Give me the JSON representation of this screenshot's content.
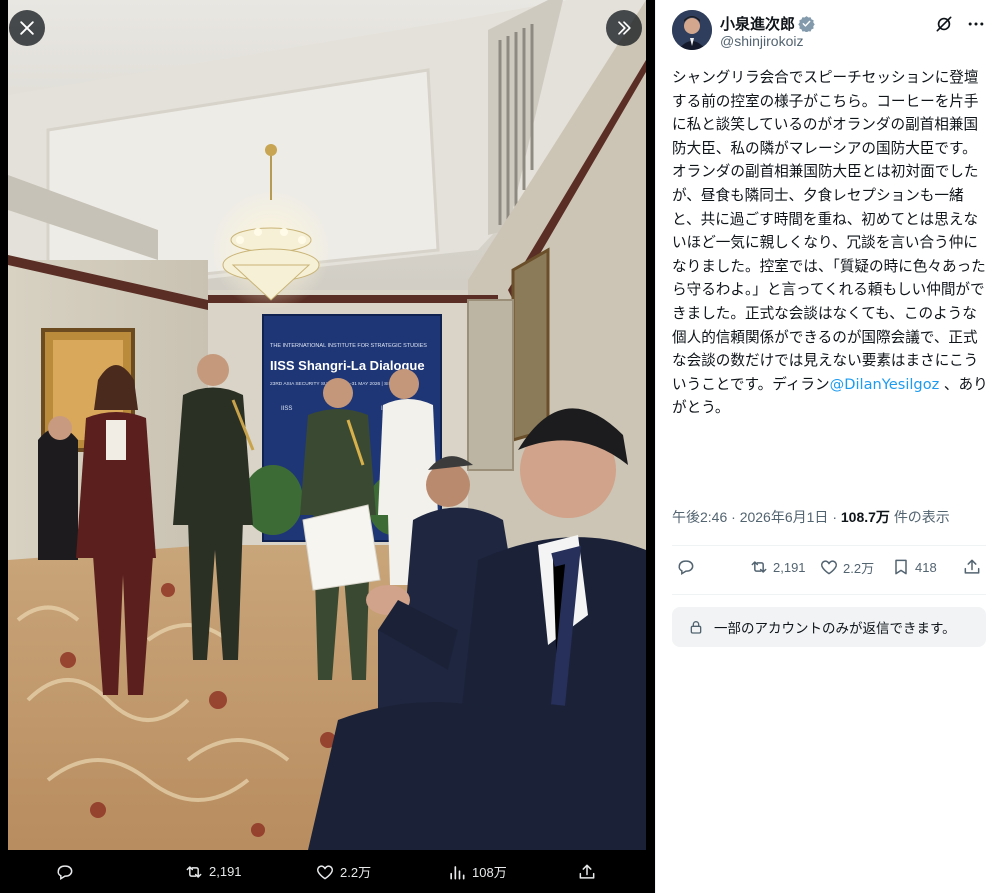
{
  "viewer": {
    "close_icon": "close-icon",
    "expand_icon": "chevrons-right-icon",
    "photo": {
      "banner_small": "THE INTERNATIONAL INSTITUTE FOR STRATEGIC STUDIES",
      "banner_title": "IISS Shangri-La Dialogue",
      "banner_sub": "23RD ASIA SECURITY SUMMIT | 29–31 MAY 2026 | SINGAPORE",
      "banner_logo": "IISS"
    },
    "actions": {
      "reply_icon": "reply-icon",
      "retweets": "2,191",
      "likes": "2.2万",
      "views": "108万",
      "share_icon": "share-icon"
    }
  },
  "tweet": {
    "author_name": "小泉進次郎",
    "author_handle": "@shinjirokoiz",
    "text_before_mention": "シャングリラ会合でスピーチセッションに登壇する前の控室の様子がこちら。コーヒーを片手に私と談笑しているのがオランダの副首相兼国防大臣、私の隣がマレーシアの国防大臣です。オランダの副首相兼国防大臣とは初対面でしたが、昼食も隣同士、夕食レセプションも一緒と、共に過ごす時間を重ね、初めてとは思えないほど一気に親しくなり、冗談を言い合う仲になりました。控室では、「質疑の時に色々あったら守るわよ。」と言ってくれる頼もしい仲間ができました。正式な会談はなくても、このような個人的信頼関係ができるのが国際会議で、正式な会談の数だけでは見えない要素はまさにこういうことです。ディラン",
    "mention": "@DilanYesilgoz",
    "text_after_mention": " 、ありがとう。",
    "time": "午後2:46",
    "separator": "·",
    "date": "2026年6月1日",
    "views_count": "108.7万",
    "views_label": "件の表示",
    "stats": {
      "retweets": "2,191",
      "likes": "2.2万",
      "bookmarks": "418"
    },
    "reply_restriction": "一部のアカウントのみが返信できます。"
  },
  "colors": {
    "accent": "#1d9bf0",
    "text": "#0f1419",
    "muted": "#536471"
  }
}
